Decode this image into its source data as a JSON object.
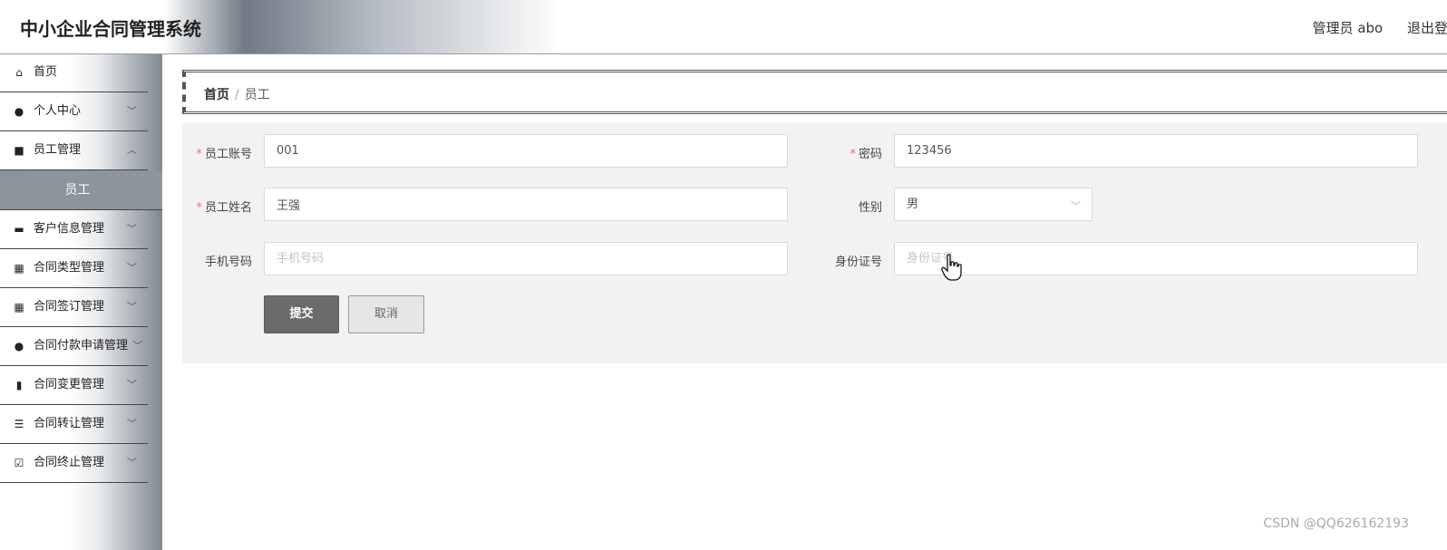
{
  "app": {
    "title": "中小企业合同管理系统"
  },
  "header": {
    "user": "管理员 abo",
    "logout": "退出登录"
  },
  "sidebar": {
    "items": [
      {
        "label": "首页",
        "icon": "home-icon",
        "glyph": "⌂"
      },
      {
        "label": "个人中心",
        "icon": "user-icon",
        "glyph": "●"
      },
      {
        "label": "员工管理",
        "icon": "chat-icon",
        "glyph": "■"
      },
      {
        "label": "客户信息管理",
        "icon": "monitor-icon",
        "glyph": "▬"
      },
      {
        "label": "合同类型管理",
        "icon": "grid-icon",
        "glyph": "▦"
      },
      {
        "label": "合同签订管理",
        "icon": "grid-icon",
        "glyph": "▦"
      },
      {
        "label": "合同付款申请管理",
        "icon": "bulb-icon",
        "glyph": "●"
      },
      {
        "label": "合同变更管理",
        "icon": "document-icon",
        "glyph": "▮"
      },
      {
        "label": "合同转让管理",
        "icon": "list-icon",
        "glyph": "☰"
      },
      {
        "label": "合同终止管理",
        "icon": "check-document-icon",
        "glyph": "☑"
      }
    ],
    "sub_item": "员工"
  },
  "breadcrumb": {
    "home": "首页",
    "separator": "/",
    "current": "员工"
  },
  "form": {
    "account": {
      "label": "员工账号",
      "value": "001",
      "required": "*"
    },
    "password": {
      "label": "密码",
      "value": "123456",
      "required": "*"
    },
    "name": {
      "label": "员工姓名",
      "value": "王强",
      "required": "*"
    },
    "gender": {
      "label": "性别",
      "value": "男"
    },
    "phone": {
      "label": "手机号码",
      "placeholder": "手机号码"
    },
    "id_card": {
      "label": "身份证号",
      "placeholder": "身份证号"
    },
    "submit": "提交",
    "cancel": "取消"
  },
  "watermark": "CSDN @QQ626162193",
  "colors": {
    "required": "#f56c6c",
    "submit_bg": "#6b6b6b",
    "active_menu_bg": "#8b939b"
  }
}
